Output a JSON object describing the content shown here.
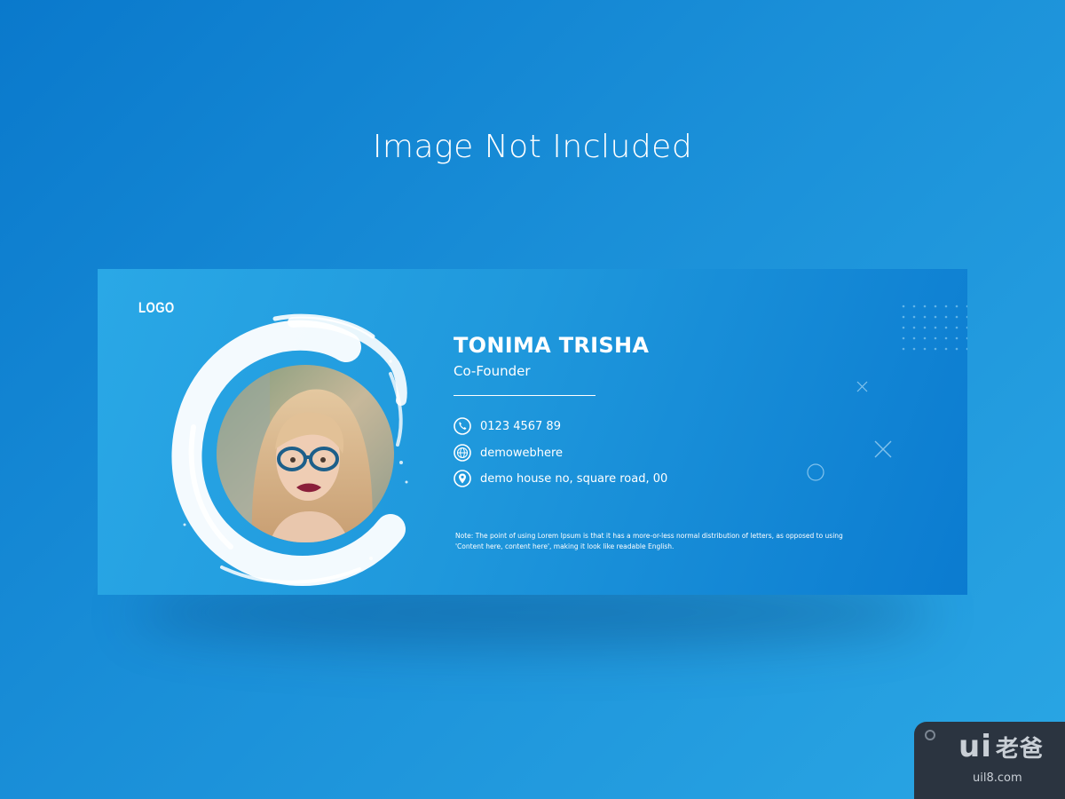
{
  "header": {
    "notice": "Image Not Included"
  },
  "signature": {
    "logo": "LOGO",
    "name": "TONIMA TRISHA",
    "role": "Co-Founder",
    "contacts": [
      {
        "icon": "phone-icon",
        "text": "0123 4567 89"
      },
      {
        "icon": "globe-icon",
        "text": "demowebhere"
      },
      {
        "icon": "location-pin-icon",
        "text": "demo house no, square road, 00"
      }
    ],
    "note_line1": "Note: The point of using Lorem Ipsum is that it has a more-or-less normal distribution of letters, as opposed to using",
    "note_line2": "'Content here, content here', making it look like readable English."
  },
  "watermark": {
    "brand": "ui",
    "brand_cjk": "老爸",
    "domain": "uil8.com"
  },
  "colors": {
    "page_background": "#1a8fd8",
    "banner_start": "#2aa8e6",
    "banner_end": "#0b7bd0",
    "text": "#ffffff",
    "watermark_bg": "#2b3440"
  }
}
